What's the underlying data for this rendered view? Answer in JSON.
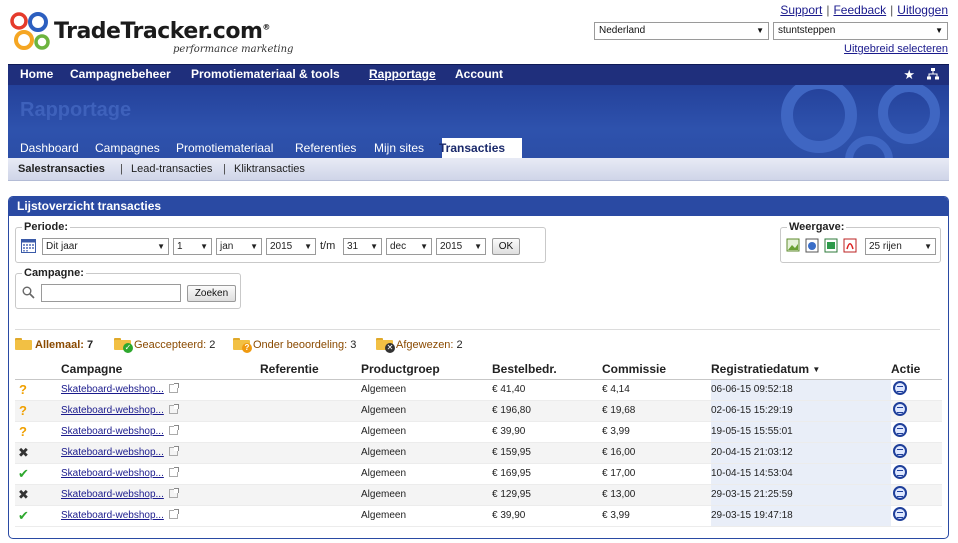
{
  "header": {
    "logo_text": "TradeTracker.com",
    "logo_reg": "®",
    "tagline": "performance marketing",
    "links": [
      "Support",
      "Feedback",
      "Uitloggen"
    ],
    "country_value": "Nederland",
    "site_value": "stuntsteppen",
    "advanced_link": "Uitgebreid selecteren"
  },
  "mainnav": {
    "items": [
      "Home",
      "Campagnebeheer",
      "Promotiemateriaal & tools",
      "Rapportage",
      "Account"
    ],
    "active": "Rapportage"
  },
  "banner": {
    "title": "Rapportage",
    "tabs": [
      "Dashboard",
      "Campagnes",
      "Promotiemateriaal",
      "Referenties",
      "Mijn sites",
      "Transacties"
    ],
    "active_tab": "Transacties"
  },
  "subnav": {
    "items": [
      "Salestransacties",
      "Lead-transacties",
      "Kliktransacties"
    ],
    "active": "Salestransacties"
  },
  "panel": {
    "title": "Lijstoverzicht transacties",
    "periode": {
      "legend": "Periode:",
      "preset": "Dit jaar",
      "from_day": "1",
      "from_month": "jan",
      "from_year": "2015",
      "separator": "t/m",
      "to_day": "31",
      "to_month": "dec",
      "to_year": "2015",
      "ok_label": "OK"
    },
    "weergave": {
      "legend": "Weergave:",
      "rows_value": "25 rijen"
    },
    "campagne": {
      "legend": "Campagne:",
      "input_value": "",
      "search_label": "Zoeken"
    },
    "status_filters": [
      {
        "label": "Allemaal:",
        "count": "7"
      },
      {
        "label": "Geaccepteerd:",
        "count": "2"
      },
      {
        "label": "Onder beoordeling:",
        "count": "3"
      },
      {
        "label": "Afgewezen:",
        "count": "2"
      }
    ],
    "table": {
      "headers": [
        "",
        "Campagne",
        "Referentie",
        "Productgroep",
        "Bestelbedr.",
        "Commissie",
        "Registratiedatum",
        "Actie"
      ],
      "rows": [
        {
          "status": "?",
          "campagne": "Skateboard-webshop...",
          "referentie": "",
          "productgroep": "Algemeen",
          "bestelbedrag": "€ 41,40",
          "commissie": "€ 4,14",
          "datum": "06-06-15 09:52:18"
        },
        {
          "status": "?",
          "campagne": "Skateboard-webshop...",
          "referentie": "",
          "productgroep": "Algemeen",
          "bestelbedrag": "€ 196,80",
          "commissie": "€ 19,68",
          "datum": "02-06-15 15:29:19"
        },
        {
          "status": "?",
          "campagne": "Skateboard-webshop...",
          "referentie": "",
          "productgroep": "Algemeen",
          "bestelbedrag": "€ 39,90",
          "commissie": "€ 3,99",
          "datum": "19-05-15 15:55:01"
        },
        {
          "status": "✖",
          "campagne": "Skateboard-webshop...",
          "referentie": "",
          "productgroep": "Algemeen",
          "bestelbedrag": "€ 159,95",
          "commissie": "€ 16,00",
          "datum": "20-04-15 21:03:12"
        },
        {
          "status": "✔",
          "campagne": "Skateboard-webshop...",
          "referentie": "",
          "productgroep": "Algemeen",
          "bestelbedrag": "€ 169,95",
          "commissie": "€ 17,00",
          "datum": "10-04-15 14:53:04"
        },
        {
          "status": "✖",
          "campagne": "Skateboard-webshop...",
          "referentie": "",
          "productgroep": "Algemeen",
          "bestelbedrag": "€ 129,95",
          "commissie": "€ 13,00",
          "datum": "29-03-15 21:25:59"
        },
        {
          "status": "✔",
          "campagne": "Skateboard-webshop...",
          "referentie": "",
          "productgroep": "Algemeen",
          "bestelbedrag": "€ 39,90",
          "commissie": "€ 3,99",
          "datum": "29-03-15 19:47:18"
        }
      ]
    }
  }
}
